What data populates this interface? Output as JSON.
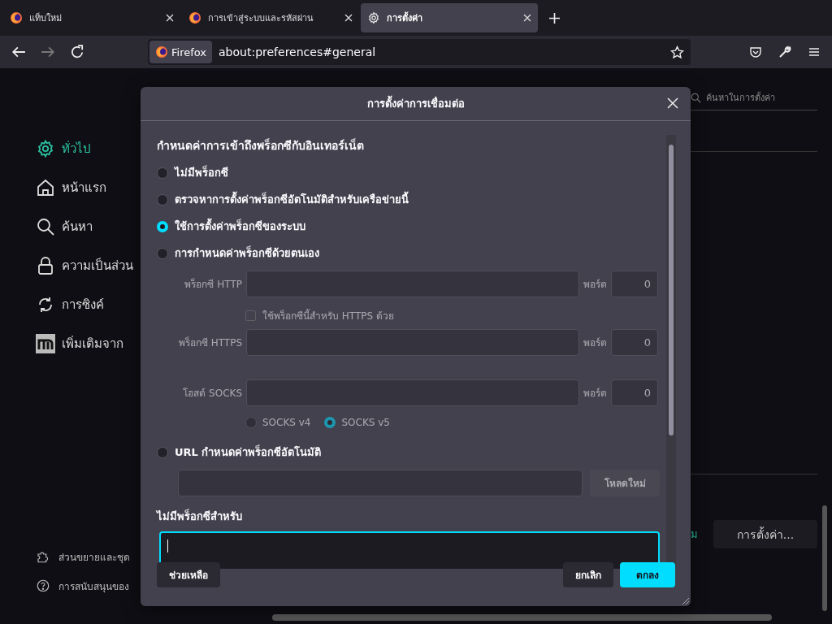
{
  "tabs": [
    {
      "label": "แท็บใหม่",
      "selected": false
    },
    {
      "label": "การเข้าสู่ระบบและรหัสผ่าน",
      "selected": false
    },
    {
      "label": "การตั้งค่า",
      "selected": true
    }
  ],
  "toolbar": {
    "identity": "Firefox",
    "url": "about:preferences#general"
  },
  "sidebar": {
    "items": [
      {
        "label": "ทั่วไป",
        "selected": true
      },
      {
        "label": "หน้าแรก",
        "selected": false
      },
      {
        "label": "ค้นหา",
        "selected": false
      },
      {
        "label": "ความเป็นส่วน",
        "selected": false
      },
      {
        "label": "การซิงค์",
        "selected": false
      },
      {
        "label": "เพิ่มเติมจาก",
        "selected": false
      }
    ],
    "footer": [
      {
        "label": "ส่วนขยายและชุด"
      },
      {
        "label": "การสนับสนุนของ"
      }
    ]
  },
  "page": {
    "search_placeholder": "ค้นหาในการตั้งค่า",
    "partial_link": "ม",
    "settings_button": "การตั้งค่า..."
  },
  "dialog": {
    "title": "การตั้งค่าการเชื่อมต่อ",
    "heading": "กำหนดค่าการเข้าถึงพร็อกซีกับอินเทอร์เน็ต",
    "modes": [
      {
        "label": "ไม่มีพร็อกซี",
        "selected": false
      },
      {
        "label": "ตรวจหาการตั้งค่าพร็อกซีอัตโนมัติสำหรับเครือข่ายนี้",
        "selected": false
      },
      {
        "label": "ใช้การตั้งค่าพร็อกซีของระบบ",
        "selected": true
      },
      {
        "label": "การกำหนดค่าพร็อกซีด้วยตนเอง",
        "selected": false
      },
      {
        "label": "URL กำหนดค่าพร็อกซีอัตโนมัติ",
        "selected": false
      }
    ],
    "manual": {
      "disabled": true,
      "http": {
        "label": "พร็อกซี HTTP",
        "port_label": "พอร์ต",
        "port": "0"
      },
      "share": {
        "label": "ใช้พร็อกซีนี้สำหรับ HTTPS ด้วย",
        "checked": false
      },
      "https": {
        "label": "พร็อกซี HTTPS",
        "port_label": "พอร์ต",
        "port": "0"
      },
      "socks": {
        "label": "โฮสต์ SOCKS",
        "port_label": "พอร์ต",
        "port": "0"
      },
      "socks_versions": [
        {
          "label": "SOCKS v4",
          "selected": false
        },
        {
          "label": "SOCKS v5",
          "selected": true
        }
      ]
    },
    "auto_url": {
      "disabled": true,
      "reload_button": "โหลดใหม่"
    },
    "no_proxy_label": "ไม่มีพร็อกซีสำหรับ",
    "buttons": {
      "help": "ช่วยเหลือ",
      "cancel": "ยกเลิก",
      "ok": "ตกลง"
    }
  }
}
